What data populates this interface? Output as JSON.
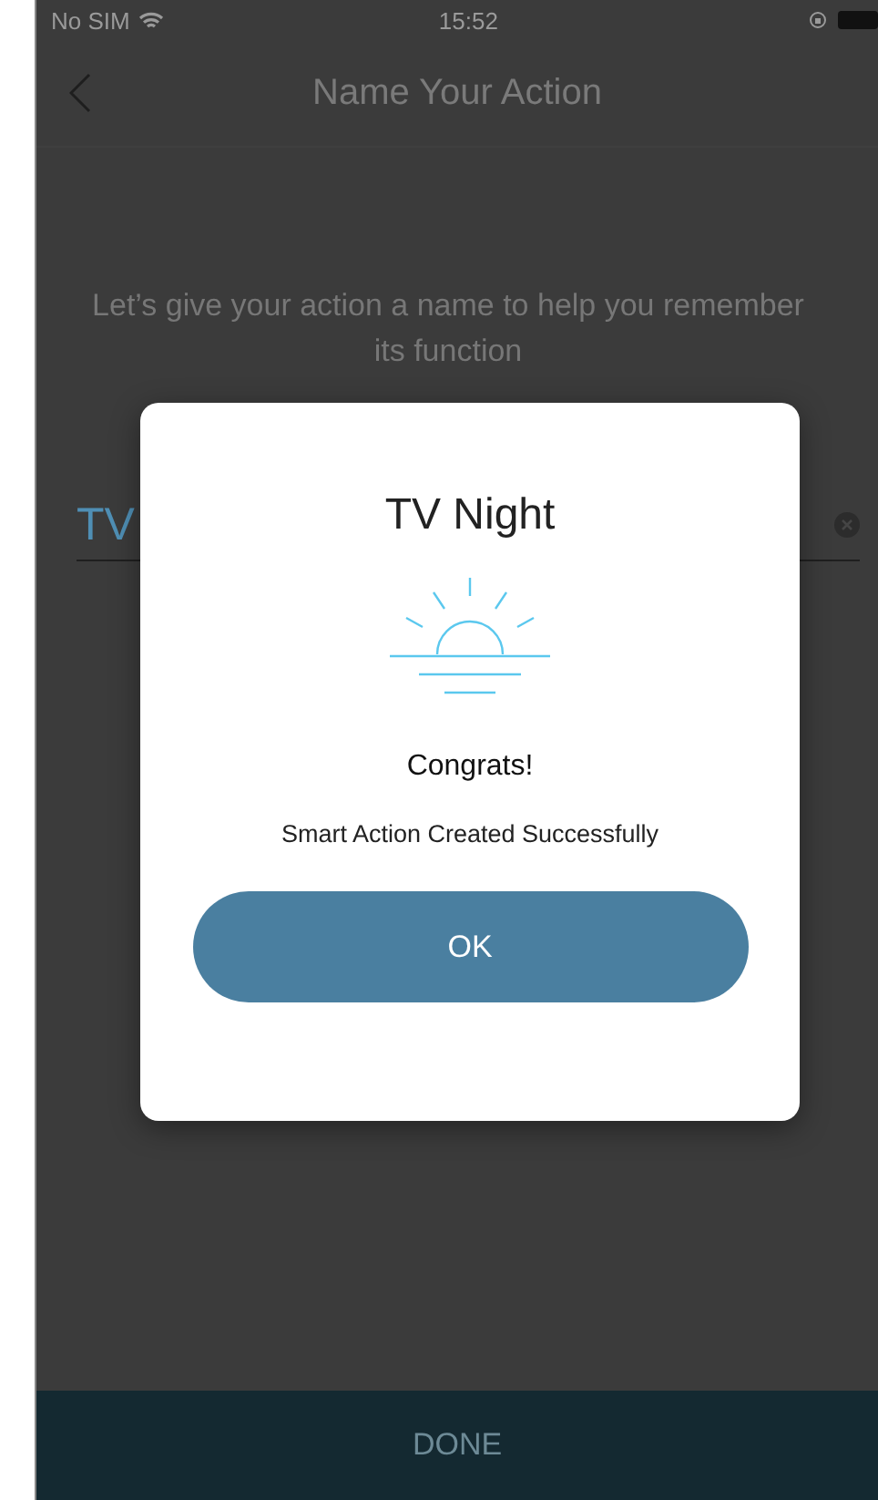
{
  "status_bar": {
    "carrier": "No SIM",
    "time": "15:52"
  },
  "nav": {
    "title": "Name Your Action"
  },
  "prompt": "Let’s give your action a name to help you remember its function",
  "name_field": {
    "value": "TV"
  },
  "done_button": {
    "label": "DONE"
  },
  "dialog": {
    "title": "TV Night",
    "heading": "Congrats!",
    "message": "Smart Action Created Successfully",
    "button": "OK"
  }
}
